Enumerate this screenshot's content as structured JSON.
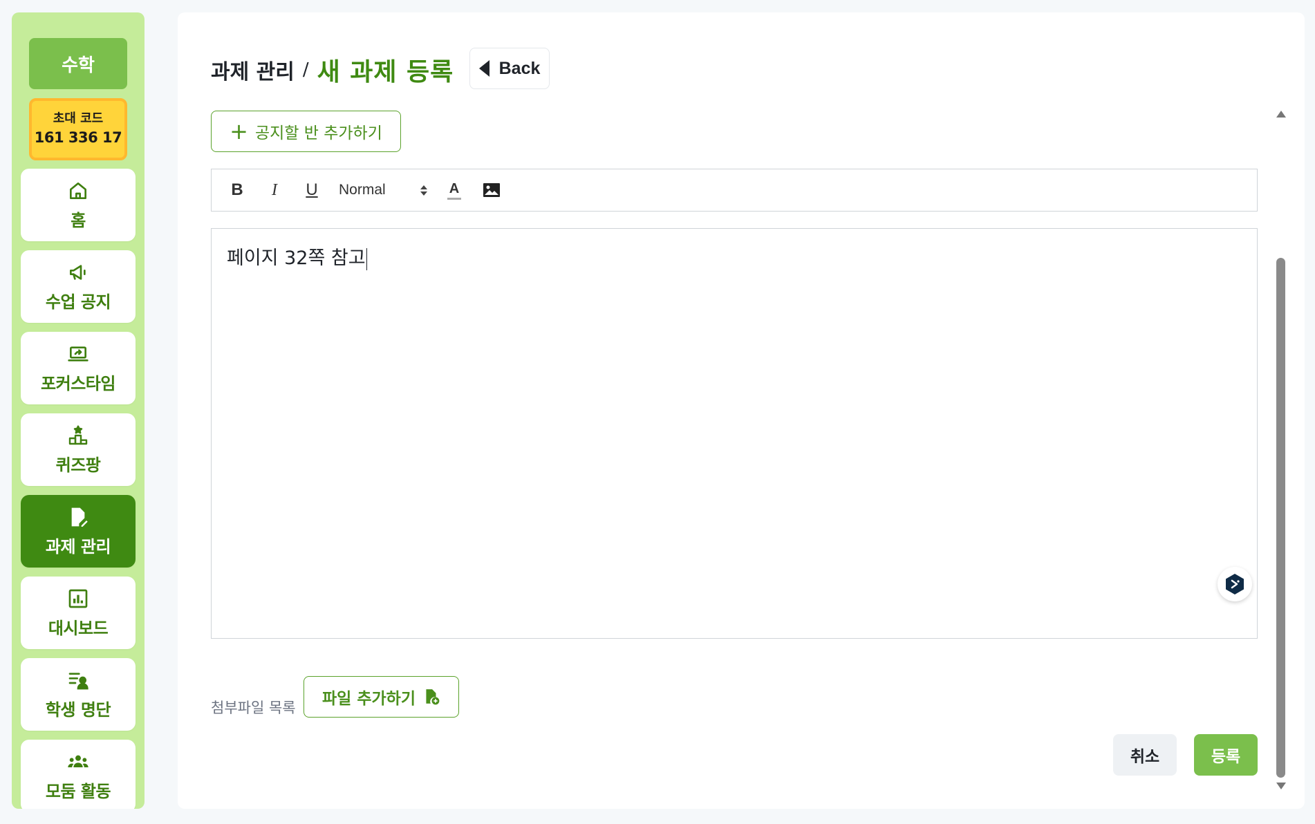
{
  "sidebar": {
    "subject": "수학",
    "invite": {
      "label": "초대 코드",
      "code": "161 336 17"
    },
    "items": [
      {
        "label": "홈",
        "icon": "home-icon"
      },
      {
        "label": "수업 공지",
        "icon": "megaphone-icon"
      },
      {
        "label": "포커스타임",
        "icon": "laptop-icon"
      },
      {
        "label": "퀴즈팡",
        "icon": "podium-icon"
      },
      {
        "label": "과제 관리",
        "icon": "edit-document-icon",
        "active": true
      },
      {
        "label": "대시보드",
        "icon": "bar-chart-icon"
      },
      {
        "label": "학생 명단",
        "icon": "student-list-icon"
      },
      {
        "label": "모둠 활동",
        "icon": "group-icon"
      }
    ]
  },
  "header": {
    "parent": "과제 관리",
    "separator": "/",
    "current": "새 과제 등록",
    "back_label": "Back"
  },
  "form": {
    "add_class_label": "공지할 반 추가하기",
    "toolbar": {
      "bold": "B",
      "italic": "I",
      "underline": "U",
      "format": "Normal",
      "color": "A"
    },
    "editor_text": "페이지 32쪽 참고",
    "attach_label": "첨부파일 목록",
    "attach_button": "파일 추가하기",
    "cancel_label": "취소",
    "submit_label": "등록"
  },
  "colors": {
    "brand_green": "#3f8a12",
    "light_green": "#c5ec9a",
    "button_green": "#7bbf4c",
    "invite_yellow": "#ffd43a"
  }
}
